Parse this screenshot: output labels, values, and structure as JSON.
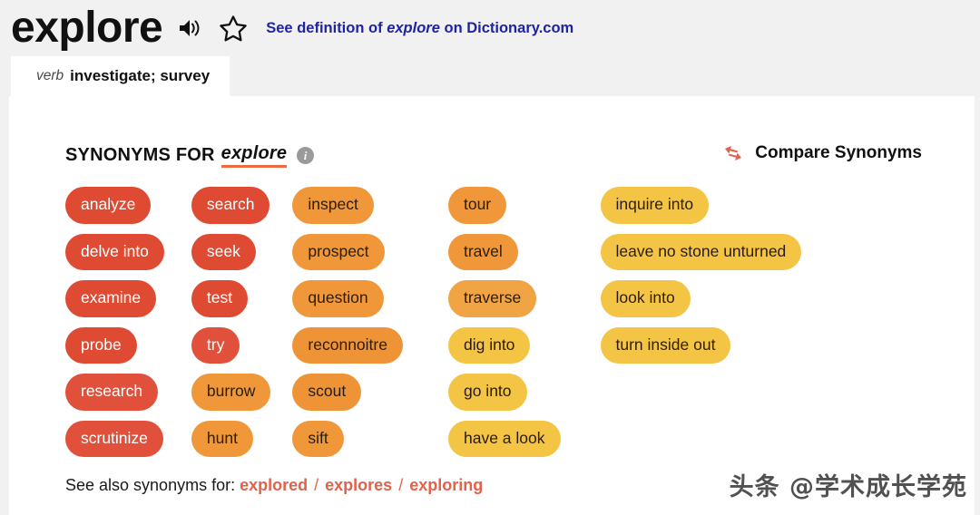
{
  "header": {
    "headword": "explore",
    "audio_icon": "speaker-icon",
    "favorite_icon": "star-outline-icon",
    "definition_link_prefix": "See definition of",
    "definition_link_word": "explore",
    "definition_link_suffix": "on Dictionary.com"
  },
  "tab": {
    "pos": "verb",
    "sense": "investigate; survey"
  },
  "synonyms_panel": {
    "title_prefix": "SYNONYMS FOR",
    "title_word": "explore",
    "info_icon_glyph": "i",
    "compare_icon": "compare-arrows-icon",
    "compare_label": "Compare Synonyms"
  },
  "colors": {
    "strong_red": "#df4a33",
    "red": "#e0503a",
    "orange": "#ef9739",
    "light_orange": "#f0a443",
    "yellow": "#f4c445",
    "white_text": "#ffffff",
    "dark_text": "#2b1d0e",
    "link_blue": "#1f23a6",
    "accent_underline": "#ed6a43",
    "footer_link": "#e2614a"
  },
  "columns": [
    {
      "chips": [
        {
          "label": "analyze",
          "bg": "#df4a33",
          "fg": "#ffffff"
        },
        {
          "label": "delve into",
          "bg": "#df4a33",
          "fg": "#ffffff"
        },
        {
          "label": "examine",
          "bg": "#df4a33",
          "fg": "#ffffff"
        },
        {
          "label": "probe",
          "bg": "#df4a33",
          "fg": "#ffffff"
        },
        {
          "label": "research",
          "bg": "#e0503a",
          "fg": "#ffffff"
        },
        {
          "label": "scrutinize",
          "bg": "#e0503a",
          "fg": "#ffffff"
        }
      ]
    },
    {
      "chips": [
        {
          "label": "search",
          "bg": "#df4a33",
          "fg": "#ffffff"
        },
        {
          "label": "seek",
          "bg": "#df4a33",
          "fg": "#ffffff"
        },
        {
          "label": "test",
          "bg": "#df4a33",
          "fg": "#ffffff"
        },
        {
          "label": "try",
          "bg": "#e0503a",
          "fg": "#ffffff"
        },
        {
          "label": "burrow",
          "bg": "#ef9739",
          "fg": "#2b1d0e"
        },
        {
          "label": "hunt",
          "bg": "#ef9739",
          "fg": "#2b1d0e"
        }
      ]
    },
    {
      "chips": [
        {
          "label": "inspect",
          "bg": "#ef9739",
          "fg": "#2b1d0e"
        },
        {
          "label": "prospect",
          "bg": "#ef9739",
          "fg": "#2b1d0e"
        },
        {
          "label": "question",
          "bg": "#ef9739",
          "fg": "#2b1d0e"
        },
        {
          "label": "reconnoitre",
          "bg": "#ee9437",
          "fg": "#2b1d0e"
        },
        {
          "label": "scout",
          "bg": "#ee9437",
          "fg": "#2b1d0e"
        },
        {
          "label": "sift",
          "bg": "#ef9739",
          "fg": "#2b1d0e"
        }
      ]
    },
    {
      "chips": [
        {
          "label": "tour",
          "bg": "#ef9739",
          "fg": "#2b1d0e"
        },
        {
          "label": "travel",
          "bg": "#ef9739",
          "fg": "#2b1d0e"
        },
        {
          "label": "traverse",
          "bg": "#f0a443",
          "fg": "#2b1d0e"
        },
        {
          "label": "dig into",
          "bg": "#f4c445",
          "fg": "#2b1d0e"
        },
        {
          "label": "go into",
          "bg": "#f4c445",
          "fg": "#2b1d0e"
        },
        {
          "label": "have a look",
          "bg": "#f4c445",
          "fg": "#2b1d0e"
        }
      ]
    },
    {
      "chips": [
        {
          "label": "inquire into",
          "bg": "#f4c445",
          "fg": "#2b1d0e"
        },
        {
          "label": "leave no stone unturned",
          "bg": "#f4c445",
          "fg": "#2b1d0e"
        },
        {
          "label": "look into",
          "bg": "#f4c445",
          "fg": "#2b1d0e"
        },
        {
          "label": "turn inside out",
          "bg": "#f4c445",
          "fg": "#2b1d0e"
        }
      ]
    }
  ],
  "footer": {
    "see_also_label": "See also synonyms for:",
    "links": [
      "explored",
      "explores",
      "exploring"
    ],
    "separator": "/"
  },
  "watermark": "头条 @学术成长学苑"
}
